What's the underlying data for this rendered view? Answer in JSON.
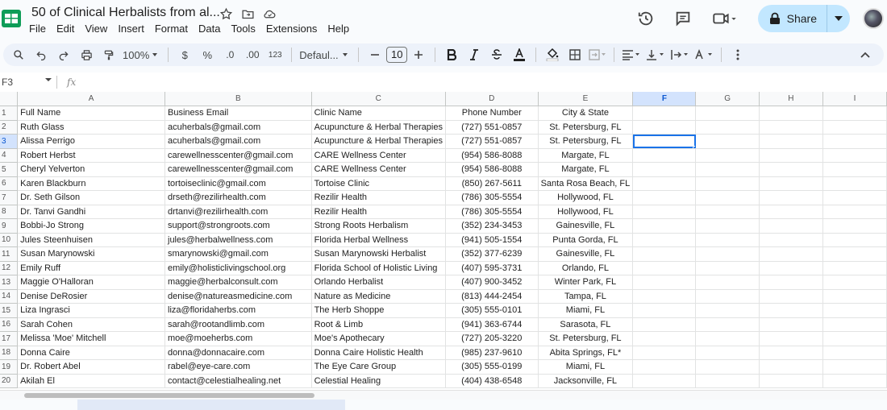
{
  "app": {
    "doc_title": "50 of Clinical Herbalists from al...",
    "menu": [
      "File",
      "Edit",
      "View",
      "Insert",
      "Format",
      "Data",
      "Tools",
      "Extensions",
      "Help"
    ],
    "share_label": "Share",
    "accent_color": "#c2e7ff",
    "brand_color": "#0f9d58"
  },
  "toolbar": {
    "zoom": "100%",
    "currency": "$",
    "percent": "%",
    "decrease_decimal": ".0",
    "increase_decimal": ".00",
    "number_format": "123",
    "font": "Defaul...",
    "font_size": "10"
  },
  "formula_bar": {
    "name_box": "F3",
    "fx": "fx"
  },
  "columns": [
    "A",
    "B",
    "C",
    "D",
    "E",
    "F",
    "G",
    "H",
    "I"
  ],
  "rows": [
    [
      "Full Name",
      "Business Email",
      "Clinic Name",
      "Phone Number",
      "City & State"
    ],
    [
      "Ruth Glass",
      "acuherbals@gmail.com",
      "Acupuncture & Herbal Therapies",
      "(727) 551-0857",
      "St. Petersburg, FL"
    ],
    [
      "Alissa Perrigo",
      "acuherbals@gmail.com",
      "Acupuncture & Herbal Therapies",
      "(727) 551-0857",
      "St. Petersburg, FL"
    ],
    [
      "Robert Herbst",
      "carewellnesscenter@gmail.com",
      "CARE Wellness Center",
      "(954) 586-8088",
      "Margate, FL"
    ],
    [
      "Cheryl Yelverton",
      "carewellnesscenter@gmail.com",
      "CARE Wellness Center",
      "(954) 586-8088",
      "Margate, FL"
    ],
    [
      "Karen Blackburn",
      "tortoiseclinic@gmail.com",
      "Tortoise Clinic",
      "(850) 267-5611",
      "Santa Rosa Beach, FL"
    ],
    [
      "Dr. Seth Gilson",
      "drseth@rezilirhealth.com",
      "Rezilir Health",
      "(786) 305-5554",
      "Hollywood, FL"
    ],
    [
      "Dr. Tanvi Gandhi",
      "drtanvi@rezilirhealth.com",
      "Rezilir Health",
      "(786) 305-5554",
      "Hollywood, FL"
    ],
    [
      "Bobbi-Jo Strong",
      "support@strongroots.com",
      "Strong Roots Herbalism",
      "(352) 234-3453",
      "Gainesville, FL"
    ],
    [
      "Jules Steenhuisen",
      "jules@herbalwellness.com",
      "Florida Herbal Wellness",
      "(941) 505-1554",
      "Punta Gorda, FL"
    ],
    [
      "Susan Marynowski",
      "smarynowski@gmail.com",
      "Susan Marynowski Herbalist",
      "(352) 377-6239",
      "Gainesville, FL"
    ],
    [
      "Emily Ruff",
      "emily@holisticlivingschool.org",
      "Florida School of Holistic Living",
      "(407) 595-3731",
      "Orlando, FL"
    ],
    [
      "Maggie O'Halloran",
      "maggie@herbalconsult.com",
      "Orlando Herbalist",
      "(407) 900-3452",
      "Winter Park, FL"
    ],
    [
      "Denise DeRosier",
      "denise@natureasmedicine.com",
      "Nature as Medicine",
      "(813) 444-2454",
      "Tampa, FL"
    ],
    [
      "Liza Ingrasci",
      "liza@floridaherbs.com",
      "The Herb Shoppe",
      "(305) 555-0101",
      "Miami, FL"
    ],
    [
      "Sarah Cohen",
      "sarah@rootandlimb.com",
      "Root & Limb",
      "(941) 363-6744",
      "Sarasota, FL"
    ],
    [
      "Melissa 'Moe' Mitchell",
      "moe@moeherbs.com",
      "Moe's Apothecary",
      "(727) 205-3220",
      "St. Petersburg, FL"
    ],
    [
      "Donna Caire",
      "donna@donnacaire.com",
      "Donna Caire Holistic Health",
      "(985) 237-9610",
      "Abita Springs, FL*"
    ],
    [
      "Dr. Robert Abel",
      "rabel@eye-care.com",
      "The Eye Care Group",
      "(305) 555-0199",
      "Miami, FL"
    ],
    [
      "Akilah El",
      "contact@celestialhealing.net",
      "Celestial Healing",
      "(404) 438-6548",
      "Jacksonville, FL"
    ]
  ],
  "selected_cell": "F3"
}
